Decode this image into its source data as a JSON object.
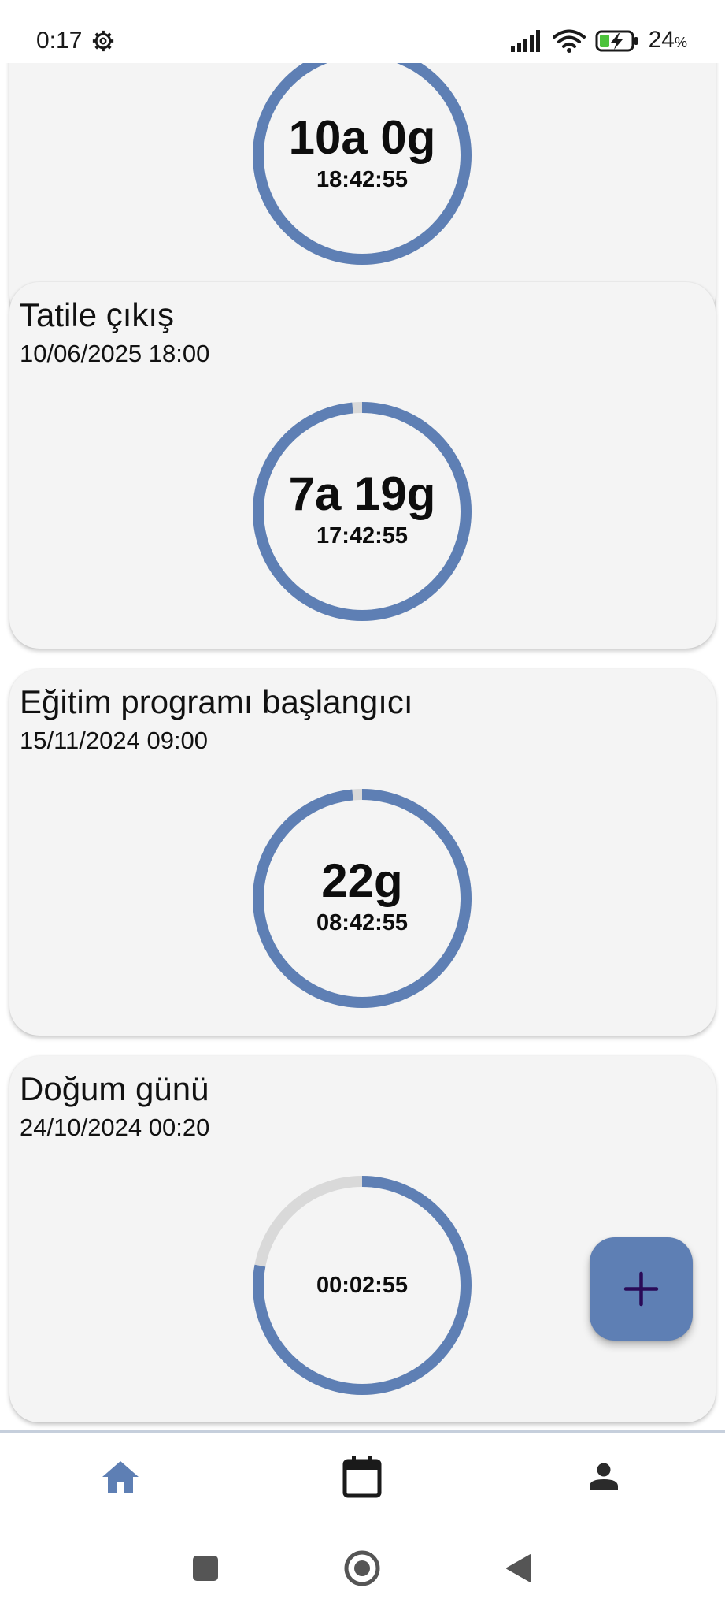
{
  "status_bar": {
    "time": "0:17",
    "battery_percent": "24",
    "battery_unit": "%",
    "icons": [
      "settings-gear-icon",
      "signal-icon",
      "wifi-icon",
      "battery-charging-icon"
    ]
  },
  "colors": {
    "accent": "#5e7fb4",
    "ring_track": "#d9d9d9",
    "card_background": "#f4f4f4",
    "fab_plus": "#2a0a57",
    "nav_active": "#5e7fb4",
    "nav_inactive": "#1a1a1a"
  },
  "events": [
    {
      "title": "",
      "date": "",
      "remaining_main": "10a 0g",
      "remaining_time": "18:42:55",
      "ring_progress": 1.0
    },
    {
      "title": "Tatile çıkış",
      "date": "10/06/2025 18:00",
      "remaining_main": "7a 19g",
      "remaining_time": "17:42:55",
      "ring_progress": 0.985
    },
    {
      "title": "Eğitim programı başlangıcı",
      "date": "15/11/2024 09:00",
      "remaining_main": "22g",
      "remaining_time": "08:42:55",
      "ring_progress": 0.985
    },
    {
      "title": "Doğum günü",
      "date": "24/10/2024 00:20",
      "remaining_main": "",
      "remaining_time": "00:02:55",
      "ring_progress": 0.78
    }
  ],
  "fab": {
    "icon": "plus-icon"
  },
  "bottom_nav": {
    "items": [
      {
        "icon": "home-icon",
        "active": true
      },
      {
        "icon": "calendar-icon",
        "active": false
      },
      {
        "icon": "person-icon",
        "active": false
      }
    ]
  },
  "system_nav": {
    "items": [
      "recents-square-icon",
      "home-circle-icon",
      "back-triangle-icon"
    ]
  }
}
